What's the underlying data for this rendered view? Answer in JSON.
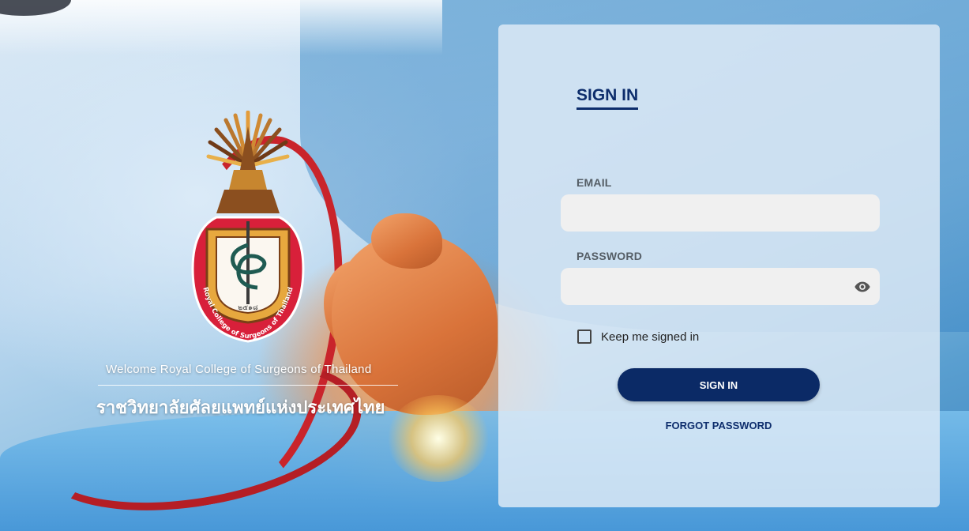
{
  "branding": {
    "crest_lettering": "Royal College of Surgeons of Thailand",
    "welcome_text": "Welcome Royal College of Surgeons of Thailand",
    "thai_name": "ราชวิทยาลัยศัลยแพทย์แห่งประเทศไทย"
  },
  "signin": {
    "title": "SIGN IN",
    "email_label": "EMAIL",
    "email_value": "",
    "password_label": "PASSWORD",
    "password_value": "",
    "password_toggle_icon": "eye-icon",
    "remember_label": "Keep me signed in",
    "remember_checked": false,
    "submit_label": "SIGN IN",
    "forgot_label": "FORGOT PASSWORD"
  },
  "colors": {
    "primary": "#0b2a66",
    "panel_background": "#e1ecf6",
    "input_background": "#f0f0f0",
    "crest_red": "#d8203a"
  }
}
